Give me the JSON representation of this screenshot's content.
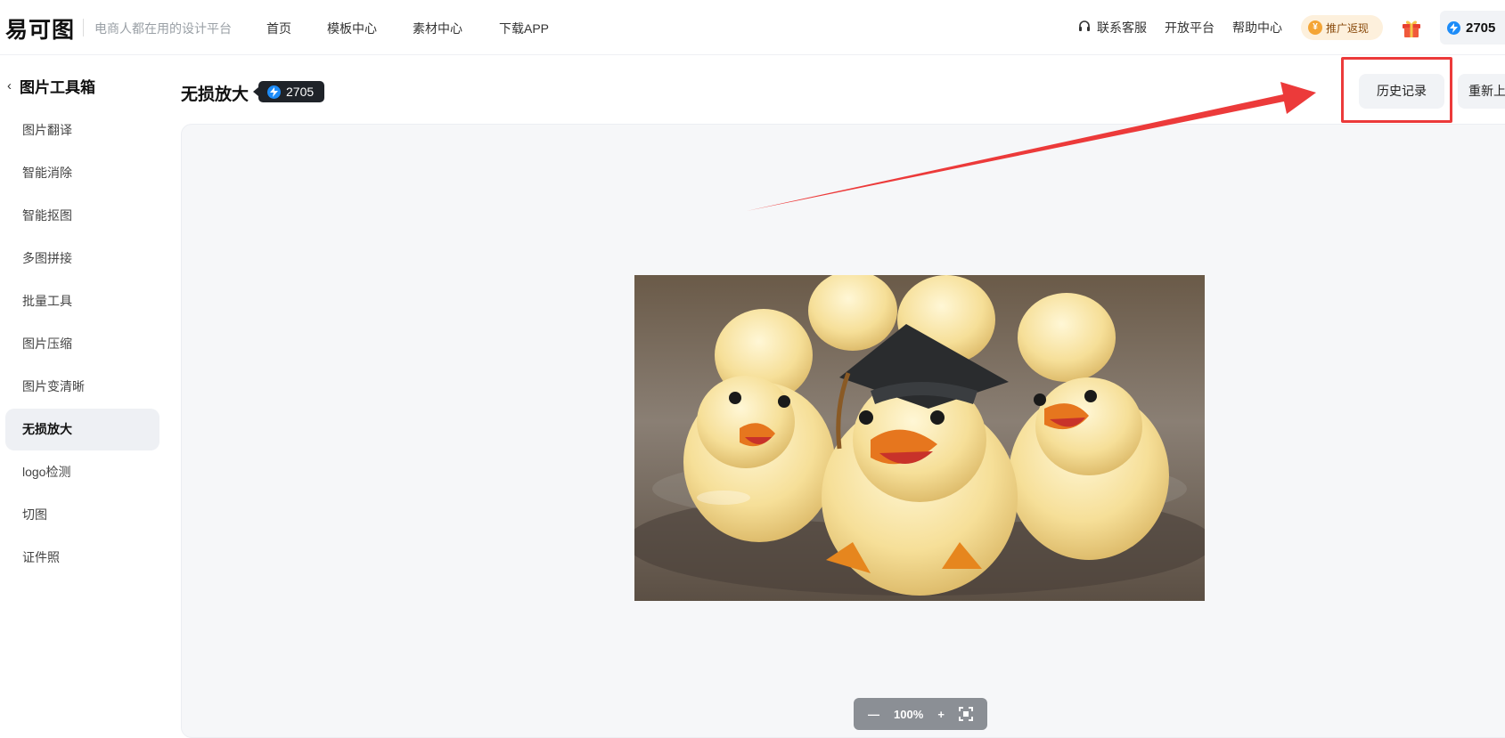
{
  "header": {
    "logo": "易可图",
    "slogan": "电商人都在用的设计平台",
    "nav": [
      "首页",
      "模板中心",
      "素材中心",
      "下载APP"
    ],
    "right_links": [
      "联系客服",
      "开放平台",
      "帮助中心"
    ],
    "promo_label": "推广返现",
    "credits": "2705"
  },
  "sidebar": {
    "back_title": "图片工具箱",
    "items": [
      {
        "label": "图片翻译"
      },
      {
        "label": "智能消除"
      },
      {
        "label": "智能抠图"
      },
      {
        "label": "多图拼接"
      },
      {
        "label": "批量工具"
      },
      {
        "label": "图片压缩"
      },
      {
        "label": "图片变清晰"
      },
      {
        "label": "无损放大",
        "active": true
      },
      {
        "label": "logo检测"
      },
      {
        "label": "切图"
      },
      {
        "label": "证件照"
      }
    ]
  },
  "main": {
    "title": "无损放大",
    "title_badge": "2705",
    "history_button": "历史记录",
    "reupload_button": "重新上"
  },
  "zoom": {
    "minus": "—",
    "level": "100%",
    "plus": "+"
  },
  "colors": {
    "accent_blue": "#1d8cf8",
    "annotation_red": "#ec3a3a"
  }
}
